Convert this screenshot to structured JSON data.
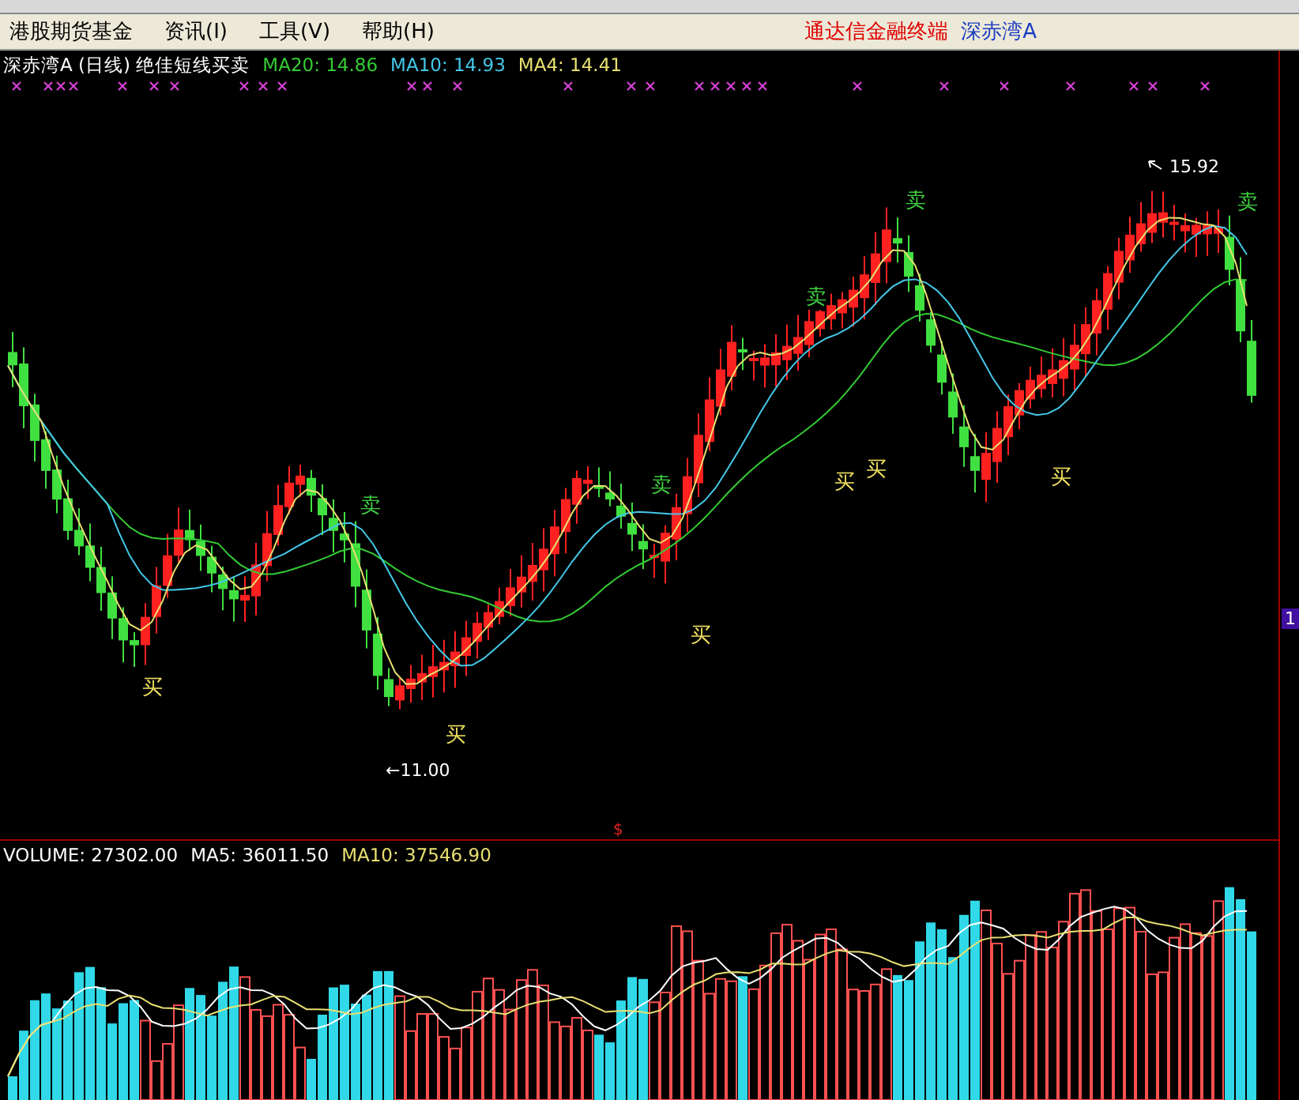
{
  "menu": [
    {
      "label": "港股期货基金"
    },
    {
      "label": "资讯(I)"
    },
    {
      "label": "工具(V)"
    },
    {
      "label": "帮助(H)"
    }
  ],
  "brand": "通达信金融终端",
  "stock_name": "深赤湾A",
  "price_pane": {
    "title": "深赤湾A (日线) 绝佳短线买卖",
    "indicators": [
      {
        "label": "MA20: 14.86",
        "color": "#33cc33"
      },
      {
        "label": "MA10: 14.93",
        "color": "#44c8e8"
      },
      {
        "label": "MA4: 14.41",
        "color": "#e8e070"
      }
    ],
    "signals": [
      {
        "text": "买",
        "kind": "buy"
      },
      {
        "text": "卖",
        "kind": "sell"
      },
      {
        "text": "买",
        "kind": "buy"
      },
      {
        "text": "卖",
        "kind": "sell"
      },
      {
        "text": "买",
        "kind": "buy"
      },
      {
        "text": "卖",
        "kind": "sell"
      },
      {
        "text": "买",
        "kind": "buy"
      },
      {
        "text": "买",
        "kind": "buy"
      },
      {
        "text": "卖",
        "kind": "sell"
      },
      {
        "text": "买",
        "kind": "buy"
      },
      {
        "text": "卖",
        "kind": "sell"
      }
    ],
    "annotations": [
      {
        "text": "15.92",
        "kind": "high"
      },
      {
        "text": "←11.00",
        "kind": "low"
      }
    ],
    "axis_badge": "1"
  },
  "volume_pane": {
    "marker": "$",
    "indicators": [
      {
        "label": "VOLUME: 27302.00",
        "color": "#ffffff"
      },
      {
        "label": "MA5: 36011.50",
        "color": "#ffffff"
      },
      {
        "label": "MA10: 37546.90",
        "color": "#e8e070"
      }
    ]
  }
}
